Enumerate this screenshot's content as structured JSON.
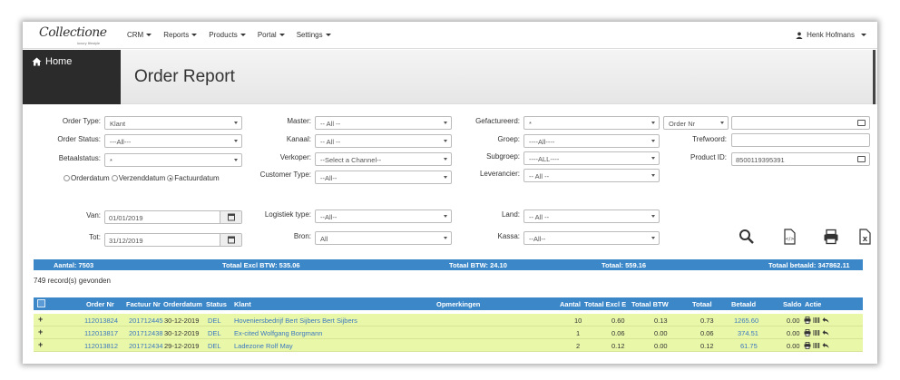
{
  "nav": {
    "logo_text": "Collectione",
    "logo_sub": "luxury lifestyle",
    "menu": [
      "CRM",
      "Reports",
      "Products",
      "Portal",
      "Settings"
    ],
    "user": "Henk Hofmans"
  },
  "sidebar": {
    "home": "Home"
  },
  "page_title": "Order Report",
  "filters": {
    "order_type_label": "Order Type:",
    "order_type_value": "Klant",
    "order_status_label": "Order Status:",
    "order_status_value": "---All---",
    "betaalstatus_label": "Betaalstatus:",
    "betaalstatus_value": "*",
    "master_label": "Master:",
    "master_value": "-- All --",
    "kanaal_label": "Kanaal:",
    "kanaal_value": "-- All --",
    "verkoper_label": "Verkoper:",
    "verkoper_value": "--Select a Channel--",
    "customer_type_label": "Customer Type:",
    "customer_type_value": "--All--",
    "gefactureerd_label": "Gefactureerd:",
    "gefactureerd_value": "*",
    "groep_label": "Groep:",
    "groep_value": "----All----",
    "subgroep_label": "Subgroep:",
    "subgroep_value": "----ALL----",
    "leverancier_label": "Leverancier:",
    "leverancier_value": "-- All --",
    "ordernr_select": "Order Nr",
    "ordernr_value": "",
    "trefwoord_label": "Trefwoord:",
    "trefwoord_value": "",
    "productid_label": "Product ID:",
    "productid_value": "8500119395391",
    "radio_orderdatum": "Orderdatum",
    "radio_verzenddatum": "Verzenddatum",
    "radio_factuurdatum": "Factuurdatum",
    "van_label": "Van:",
    "van_value": "01/01/2019",
    "tot_label": "Tot:",
    "tot_value": "31/12/2019",
    "logistiek_label": "Logistiek type:",
    "logistiek_value": "--All--",
    "bron_label": "Bron:",
    "bron_value": "All",
    "land_label": "Land:",
    "land_value": "-- All --",
    "kassa_label": "Kassa:",
    "kassa_value": "--All--"
  },
  "totals": {
    "aantal": "Aantal:  7503",
    "excl": "Totaal Excl BTW:  535.06",
    "btw": "Totaal BTW:  24.10",
    "totaal": "Totaal:  559.16",
    "betaald": "Totaal betaald:  347862.11"
  },
  "found": "749 record(s) gevonden",
  "table": {
    "headers": [
      "Order Nr",
      "Factuur Nr",
      "Orderdatum",
      "Status",
      "Klant",
      "Opmerkingen",
      "Aantal",
      "Totaal Excl E",
      "Totaal BTW",
      "Totaal",
      "Betaald",
      "Saldo",
      "Actie"
    ],
    "rows": [
      {
        "plus": "+",
        "order": "112013824",
        "factuur": "201712445",
        "datum": "30-12-2019",
        "status": "DEL",
        "klant": "Hoveniersbedrijf Bert Sijbers Bert Sijbers",
        "aantal": "10",
        "excl": "0.60",
        "btw": "0.13",
        "totaal": "0.73",
        "betaald": "1265.60",
        "saldo": "0.00"
      },
      {
        "plus": "+",
        "order": "112013817",
        "factuur": "201712438",
        "datum": "30-12-2019",
        "status": "DEL",
        "klant": "Ex-cited Wolfgang Borgmann",
        "aantal": "1",
        "excl": "0.06",
        "btw": "0.00",
        "totaal": "0.06",
        "betaald": "374.51",
        "saldo": "0.00"
      },
      {
        "plus": "+",
        "order": "112013812",
        "factuur": "201712434",
        "datum": "29-12-2019",
        "status": "DEL",
        "klant": "Ladezone Rolf May",
        "aantal": "2",
        "excl": "0.12",
        "btw": "0.00",
        "totaal": "0.12",
        "betaald": "61.75",
        "saldo": "0.00"
      }
    ]
  }
}
